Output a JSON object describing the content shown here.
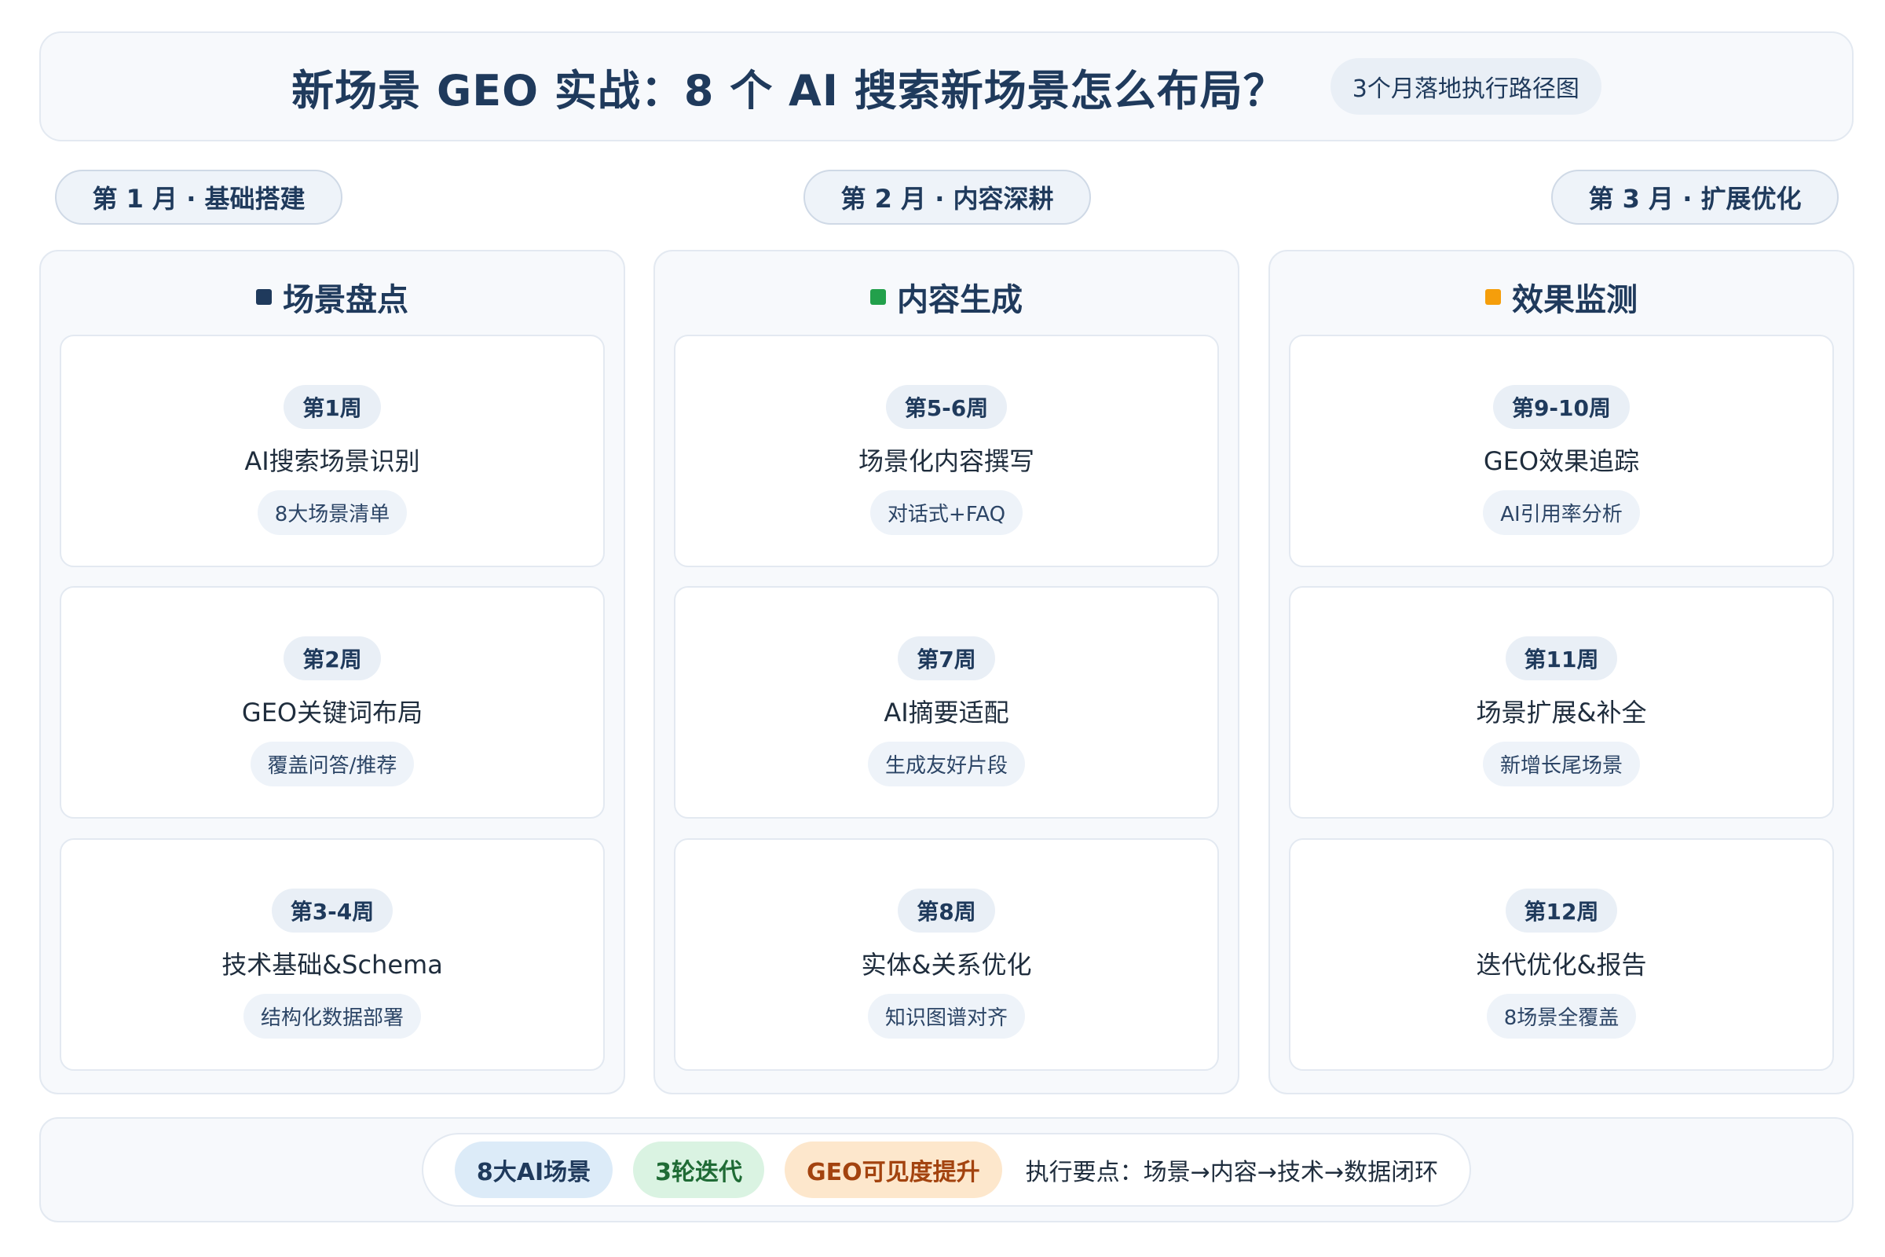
{
  "header": {
    "title": "新场景 GEO 实战：8 个 AI 搜索新场景怎么布局？",
    "subtitle": "3个月落地执行路径图"
  },
  "months": [
    {
      "label": "第 1 月 · 基础搭建"
    },
    {
      "label": "第 2 月 · 内容深耕"
    },
    {
      "label": "第 3 月 · 扩展优化"
    }
  ],
  "columns": [
    {
      "title": "场景盘点",
      "marker_color": "#1f3a5c",
      "cards": [
        {
          "week": "第1周",
          "task": "AI搜索场景识别",
          "tag": "8大场景清单"
        },
        {
          "week": "第2周",
          "task": "GEO关键词布局",
          "tag": "覆盖问答/推荐"
        },
        {
          "week": "第3-4周",
          "task": "技术基础&Schema",
          "tag": "结构化数据部署"
        }
      ]
    },
    {
      "title": "内容生成",
      "marker_color": "#22a04b",
      "cards": [
        {
          "week": "第5-6周",
          "task": "场景化内容撰写",
          "tag": "对话式+FAQ"
        },
        {
          "week": "第7周",
          "task": "AI摘要适配",
          "tag": "生成友好片段"
        },
        {
          "week": "第8周",
          "task": "实体&关系优化",
          "tag": "知识图谱对齐"
        }
      ]
    },
    {
      "title": "效果监测",
      "marker_color": "#f59e0b",
      "cards": [
        {
          "week": "第9-10周",
          "task": "GEO效果追踪",
          "tag": "AI引用率分析"
        },
        {
          "week": "第11周",
          "task": "场景扩展&补全",
          "tag": "新增长尾场景"
        },
        {
          "week": "第12周",
          "task": "迭代优化&报告",
          "tag": "8场景全覆盖"
        }
      ]
    }
  ],
  "footer": {
    "badges": [
      "8大AI场景",
      "3轮迭代",
      "GEO可见度提升"
    ],
    "note": "执行要点：场景→内容→技术→数据闭环"
  }
}
